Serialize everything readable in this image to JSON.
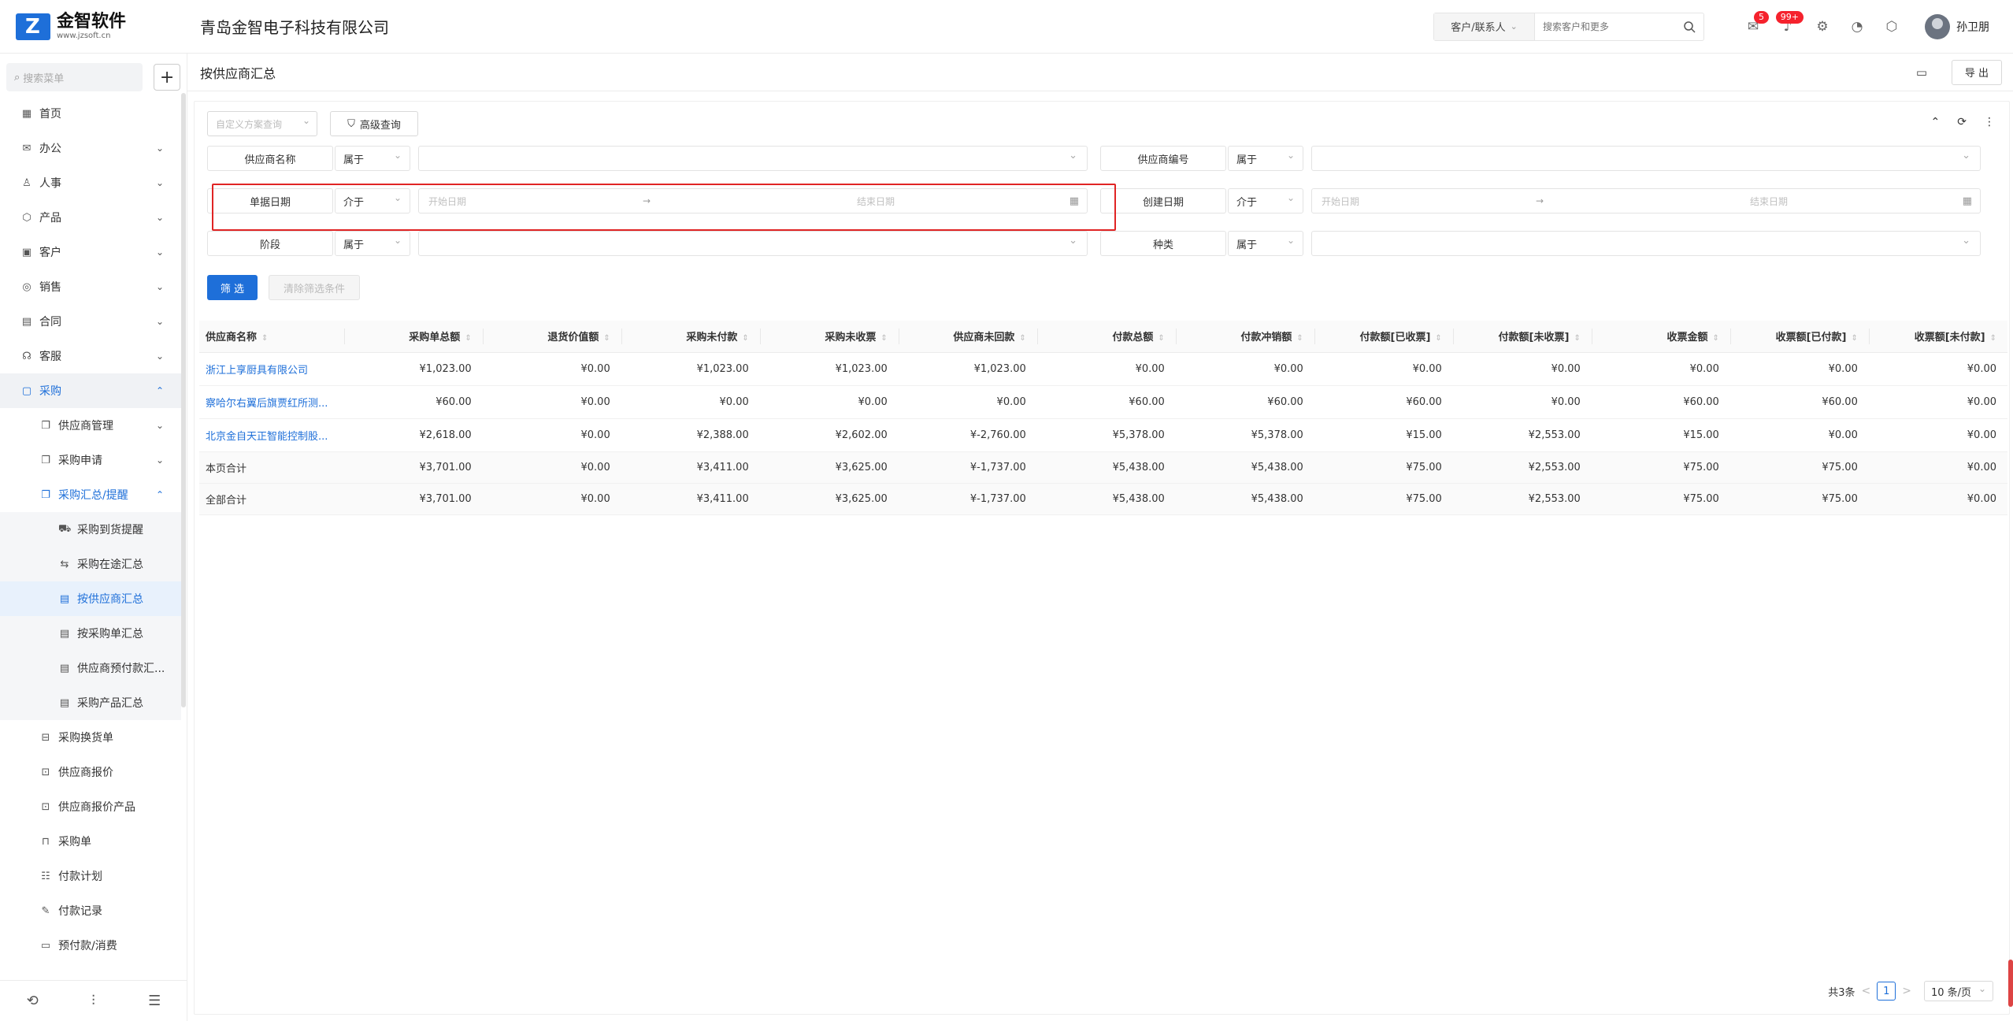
{
  "header": {
    "logo_name": "金智软件",
    "logo_sub": "www.jzsoft.cn",
    "company": "青岛金智电子科技有限公司",
    "search_type": "客户/联系人",
    "search_placeholder": "搜索客户和更多",
    "mail_badge": "5",
    "bell_badge": "99+",
    "username": "孙卫朋"
  },
  "sidebar": {
    "search_placeholder": "搜索菜单",
    "plus": "+",
    "items": [
      {
        "label": "首页",
        "icon": "▦"
      },
      {
        "label": "办公",
        "icon": "✉",
        "arrow": "⌄"
      },
      {
        "label": "人事",
        "icon": "♙",
        "arrow": "⌄"
      },
      {
        "label": "产品",
        "icon": "⬡",
        "arrow": "⌄"
      },
      {
        "label": "客户",
        "icon": "▣",
        "arrow": "⌄"
      },
      {
        "label": "销售",
        "icon": "◎",
        "arrow": "⌄"
      },
      {
        "label": "合同",
        "icon": "▤",
        "arrow": "⌄"
      },
      {
        "label": "客服",
        "icon": "☊",
        "arrow": "⌄"
      },
      {
        "label": "采购",
        "icon": "▢",
        "arrow": "⌃"
      }
    ],
    "purchase": [
      {
        "label": "供应商管理",
        "arrow": "⌄"
      },
      {
        "label": "采购申请",
        "arrow": "⌄"
      },
      {
        "label": "采购汇总/提醒",
        "arrow": "⌃"
      }
    ],
    "summary": [
      {
        "label": "采购到货提醒"
      },
      {
        "label": "采购在途汇总"
      },
      {
        "label": "按供应商汇总"
      },
      {
        "label": "按采购单汇总"
      },
      {
        "label": "供应商预付款汇..."
      },
      {
        "label": "采购产品汇总"
      }
    ],
    "more": [
      {
        "label": "采购换货单"
      },
      {
        "label": "供应商报价"
      },
      {
        "label": "供应商报价产品"
      },
      {
        "label": "采购单"
      },
      {
        "label": "付款计划"
      },
      {
        "label": "付款记录"
      },
      {
        "label": "预付款/消费"
      }
    ]
  },
  "page": {
    "title": "按供应商汇总",
    "export": "导 出"
  },
  "filters": {
    "scheme_placeholder": "自定义方案查询",
    "advanced": "高级查询",
    "supplier_name": "供应商名称",
    "supplier_code": "供应商编号",
    "doc_date": "单据日期",
    "create_date": "创建日期",
    "stage": "阶段",
    "category": "种类",
    "op_in": "属于",
    "op_between": "介于",
    "start_date": "开始日期",
    "end_date": "结束日期",
    "range_arrow": "→",
    "filter_btn": "筛 选",
    "clear_btn": "清除筛选条件"
  },
  "table": {
    "columns": [
      "供应商名称",
      "采购单总额",
      "退货价值额",
      "采购未付款",
      "采购未收票",
      "供应商未回款",
      "付款总额",
      "付款冲销额",
      "付款额[已收票]",
      "付款额[未收票]",
      "收票金额",
      "收票额[已付款]",
      "收票额[未付款]"
    ],
    "rows": [
      [
        "浙江上享厨具有限公司",
        "¥1,023.00",
        "¥0.00",
        "¥1,023.00",
        "¥1,023.00",
        "¥1,023.00",
        "¥0.00",
        "¥0.00",
        "¥0.00",
        "¥0.00",
        "¥0.00",
        "¥0.00",
        "¥0.00"
      ],
      [
        "察哈尔右翼后旗贾红所测...",
        "¥60.00",
        "¥0.00",
        "¥0.00",
        "¥0.00",
        "¥0.00",
        "¥60.00",
        "¥60.00",
        "¥60.00",
        "¥0.00",
        "¥60.00",
        "¥60.00",
        "¥0.00"
      ],
      [
        "北京金自天正智能控制股...",
        "¥2,618.00",
        "¥0.00",
        "¥2,388.00",
        "¥2,602.00",
        "¥-2,760.00",
        "¥5,378.00",
        "¥5,378.00",
        "¥15.00",
        "¥2,553.00",
        "¥15.00",
        "¥0.00",
        "¥0.00"
      ]
    ],
    "sums": [
      [
        "本页合计",
        "¥3,701.00",
        "¥0.00",
        "¥3,411.00",
        "¥3,625.00",
        "¥-1,737.00",
        "¥5,438.00",
        "¥5,438.00",
        "¥75.00",
        "¥2,553.00",
        "¥75.00",
        "¥75.00",
        "¥0.00"
      ],
      [
        "全部合计",
        "¥3,701.00",
        "¥0.00",
        "¥3,411.00",
        "¥3,625.00",
        "¥-1,737.00",
        "¥5,438.00",
        "¥5,438.00",
        "¥75.00",
        "¥2,553.00",
        "¥75.00",
        "¥75.00",
        "¥0.00"
      ]
    ]
  },
  "pager": {
    "total": "共3条",
    "prev": "<",
    "page": "1",
    "next": ">",
    "size": "10 条/页"
  }
}
